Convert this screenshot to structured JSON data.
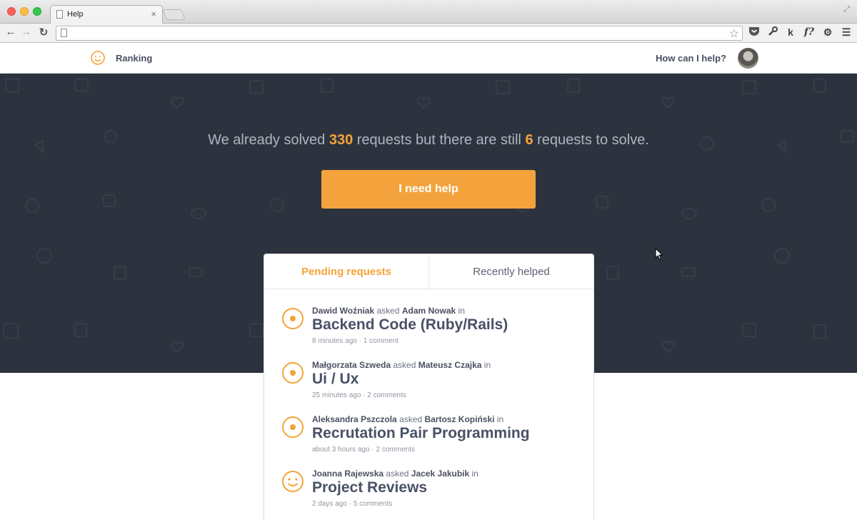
{
  "browser": {
    "tab_title": "Help",
    "tab_close": "×",
    "url": "",
    "fullscreen": "⤢"
  },
  "header": {
    "nav_ranking": "Ranking",
    "help_link": "How can I help?"
  },
  "hero": {
    "text_before": "We already solved ",
    "solved_count": "330",
    "text_middle": " requests but there are still ",
    "pending_count": "6",
    "text_after": " requests to solve.",
    "button_label": "I need help"
  },
  "panel": {
    "tabs": [
      {
        "label": "Pending requests",
        "active": true
      },
      {
        "label": "Recently helped",
        "active": false
      }
    ],
    "requests": [
      {
        "requester": "Dawid Woźniak",
        "verb": " asked ",
        "helper": "Adam Nowak",
        "suffix": " in",
        "topic": "Backend Code (Ruby/Rails)",
        "meta": "8 minutes ago · 1 comment",
        "icon": "target-icon"
      },
      {
        "requester": "Małgorzata Szweda",
        "verb": " asked ",
        "helper": "Mateusz Czajka",
        "suffix": " in",
        "topic": "Ui / Ux",
        "meta": "25 minutes ago · 2 comments",
        "icon": "target-icon"
      },
      {
        "requester": "Aleksandra Pszczola",
        "verb": " asked ",
        "helper": "Bartosz Kopiński",
        "suffix": " in",
        "topic": "Recrutation Pair Programming",
        "meta": "about 3 hours ago · 2 comments",
        "icon": "target-icon"
      },
      {
        "requester": "Joanna Rajewska",
        "verb": " asked ",
        "helper": "Jacek Jakubik",
        "suffix": " in",
        "topic": "Project Reviews",
        "meta": "2 days ago · 5 comments",
        "icon": "smiley-icon"
      }
    ]
  },
  "colors": {
    "accent": "#f4a338",
    "hero_bg": "#2d333e",
    "text_dark": "#4a5166"
  }
}
